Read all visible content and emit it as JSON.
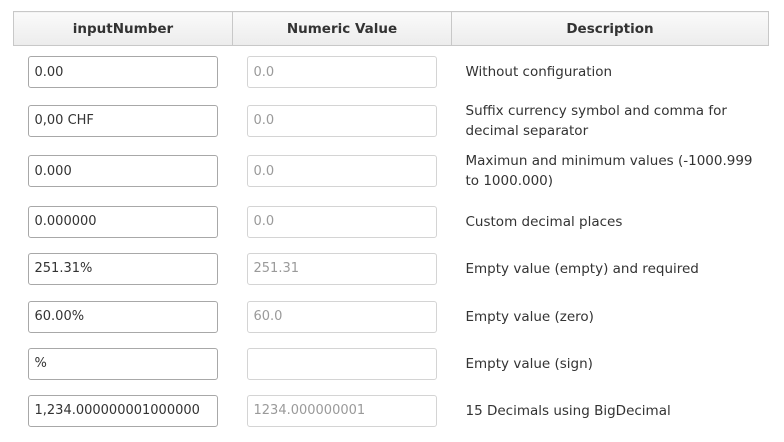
{
  "headers": {
    "input_number": "inputNumber",
    "numeric_value": "Numeric Value",
    "description": "Description"
  },
  "rows": [
    {
      "input_value": "0.00",
      "numeric_value": "0.0",
      "description": "Without configuration"
    },
    {
      "input_value": "0,00 CHF",
      "numeric_value": "0.0",
      "description": "Suffix currency symbol and comma for decimal separator"
    },
    {
      "input_value": "0.000",
      "numeric_value": "0.0",
      "description": "Maximun and minimum values (-1000.999 to 1000.000)"
    },
    {
      "input_value": "0.000000",
      "numeric_value": "0.0",
      "description": "Custom decimal places"
    },
    {
      "input_value": "251.31%",
      "numeric_value": "251.31",
      "description": "Empty value (empty) and required"
    },
    {
      "input_value": "60.00%",
      "numeric_value": "60.0",
      "description": "Empty value (zero)"
    },
    {
      "input_value": "%",
      "numeric_value": "",
      "description": "Empty value (sign)"
    },
    {
      "input_value": "1,234.000000001000000",
      "numeric_value": "1234.000000001",
      "description": "15 Decimals using BigDecimal"
    }
  ]
}
